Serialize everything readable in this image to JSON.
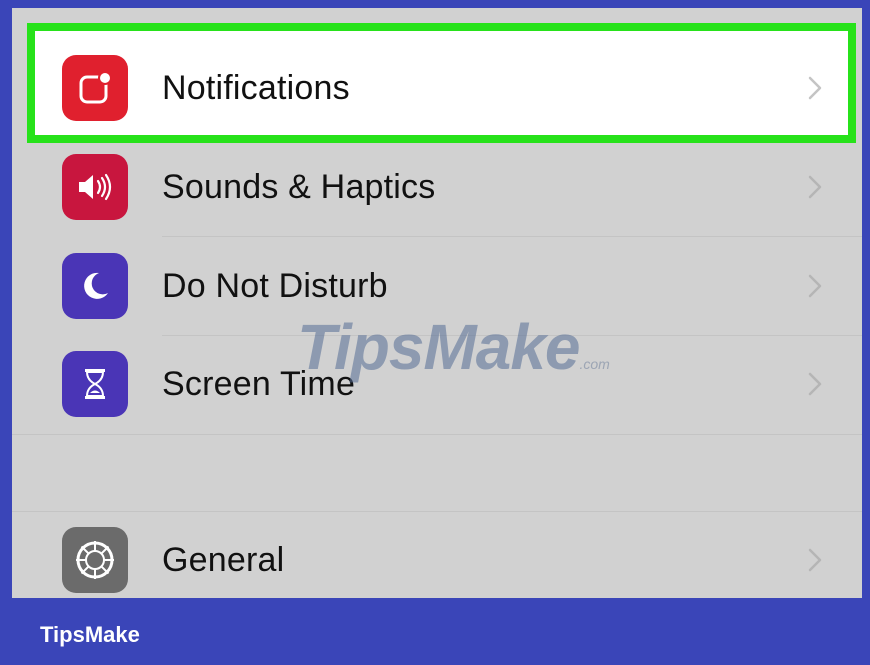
{
  "settings": {
    "items": [
      {
        "label": "Notifications",
        "icon": "notifications-icon",
        "icon_color": "#e0202e",
        "highlighted": true
      },
      {
        "label": "Sounds & Haptics",
        "icon": "speaker-icon",
        "icon_color": "#c8163e"
      },
      {
        "label": "Do Not Disturb",
        "icon": "moon-icon",
        "icon_color": "#4a35b6"
      },
      {
        "label": "Screen Time",
        "icon": "hourglass-icon",
        "icon_color": "#4a35b6"
      },
      {
        "label": "General",
        "icon": "gear-icon",
        "icon_color": "#6b6b6b"
      }
    ]
  },
  "highlight_color": "#27e21a",
  "frame_color": "#3a45b8",
  "watermark": {
    "text": "TipsMake",
    "suffix": ".com"
  },
  "footer": {
    "brand": "TipsMake"
  }
}
